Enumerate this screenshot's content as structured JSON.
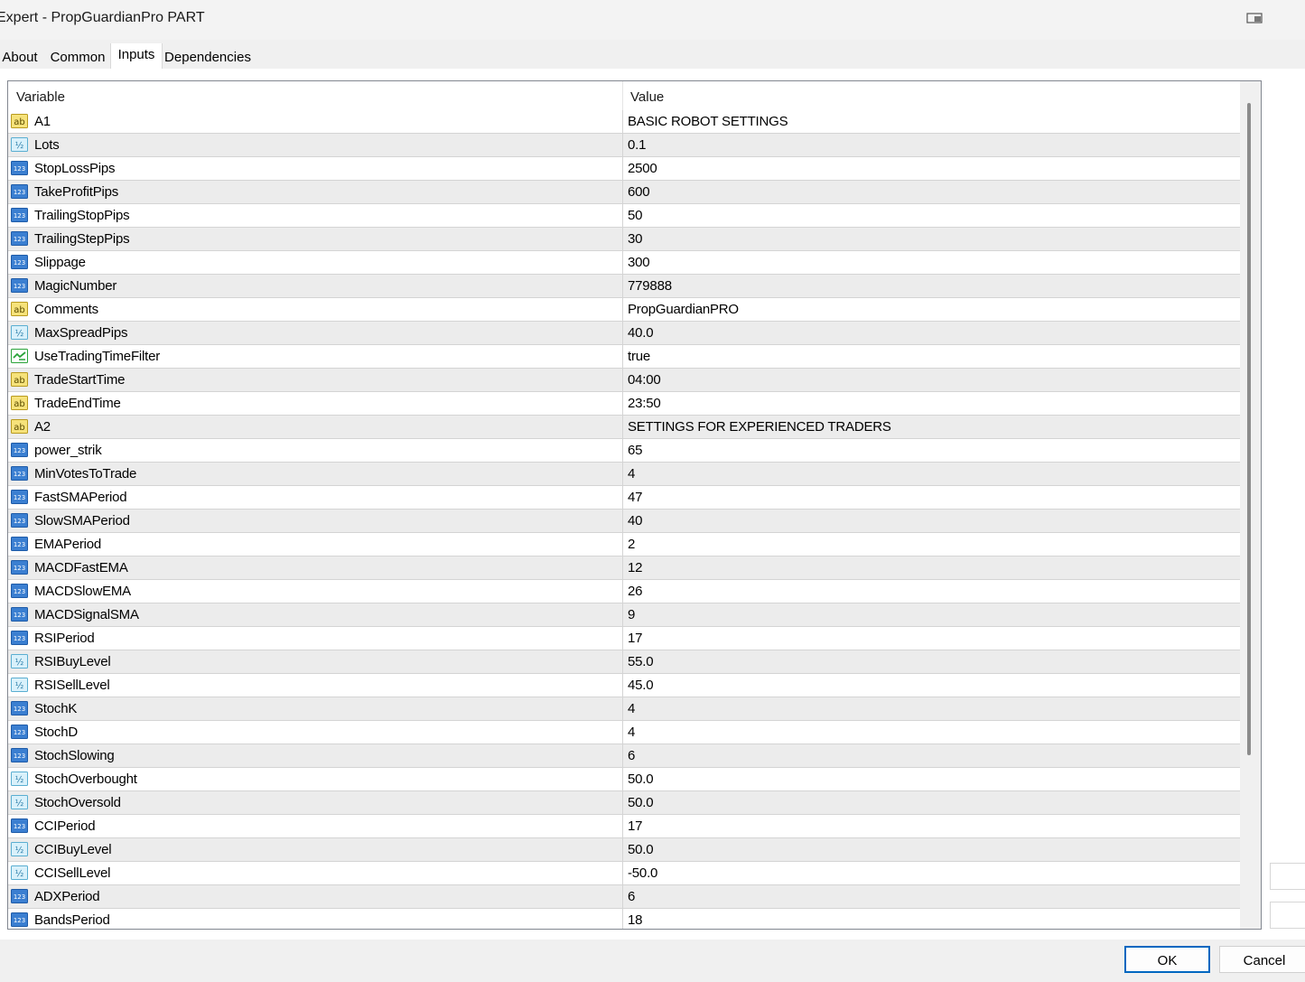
{
  "window": {
    "title": "Expert - PropGuardianPro PART"
  },
  "tabs": [
    {
      "label": "About",
      "active": false
    },
    {
      "label": "Common",
      "active": false
    },
    {
      "label": "Inputs",
      "active": true
    },
    {
      "label": "Dependencies",
      "active": false
    }
  ],
  "grid": {
    "columns": {
      "variable": "Variable",
      "value": "Value"
    },
    "rows": [
      {
        "type": "string",
        "icon": "string-type-icon",
        "name": "A1",
        "value": "BASIC ROBOT SETTINGS"
      },
      {
        "type": "double",
        "icon": "double-type-icon",
        "name": "Lots",
        "value": "0.1"
      },
      {
        "type": "int",
        "icon": "integer-type-icon",
        "name": "StopLossPips",
        "value": "2500"
      },
      {
        "type": "int",
        "icon": "integer-type-icon",
        "name": "TakeProfitPips",
        "value": "600"
      },
      {
        "type": "int",
        "icon": "integer-type-icon",
        "name": "TrailingStopPips",
        "value": "50"
      },
      {
        "type": "int",
        "icon": "integer-type-icon",
        "name": "TrailingStepPips",
        "value": "30"
      },
      {
        "type": "int",
        "icon": "integer-type-icon",
        "name": "Slippage",
        "value": "300"
      },
      {
        "type": "int",
        "icon": "integer-type-icon",
        "name": "MagicNumber",
        "value": "779888"
      },
      {
        "type": "string",
        "icon": "string-type-icon",
        "name": "Comments",
        "value": "PropGuardianPRO"
      },
      {
        "type": "double",
        "icon": "double-type-icon",
        "name": "MaxSpreadPips",
        "value": "40.0"
      },
      {
        "type": "bool",
        "icon": "boolean-type-icon",
        "name": "UseTradingTimeFilter",
        "value": "true"
      },
      {
        "type": "string",
        "icon": "string-type-icon",
        "name": "TradeStartTime",
        "value": "04:00"
      },
      {
        "type": "string",
        "icon": "string-type-icon",
        "name": "TradeEndTime",
        "value": "23:50"
      },
      {
        "type": "string",
        "icon": "string-type-icon",
        "name": "A2",
        "value": "SETTINGS FOR EXPERIENCED TRADERS"
      },
      {
        "type": "int",
        "icon": "integer-type-icon",
        "name": "power_strik",
        "value": "65"
      },
      {
        "type": "int",
        "icon": "integer-type-icon",
        "name": "MinVotesToTrade",
        "value": "4"
      },
      {
        "type": "int",
        "icon": "integer-type-icon",
        "name": "FastSMAPeriod",
        "value": "47"
      },
      {
        "type": "int",
        "icon": "integer-type-icon",
        "name": "SlowSMAPeriod",
        "value": "40"
      },
      {
        "type": "int",
        "icon": "integer-type-icon",
        "name": "EMAPeriod",
        "value": "2"
      },
      {
        "type": "int",
        "icon": "integer-type-icon",
        "name": "MACDFastEMA",
        "value": "12"
      },
      {
        "type": "int",
        "icon": "integer-type-icon",
        "name": "MACDSlowEMA",
        "value": "26"
      },
      {
        "type": "int",
        "icon": "integer-type-icon",
        "name": "MACDSignalSMA",
        "value": "9"
      },
      {
        "type": "int",
        "icon": "integer-type-icon",
        "name": "RSIPeriod",
        "value": "17"
      },
      {
        "type": "double",
        "icon": "double-type-icon",
        "name": "RSIBuyLevel",
        "value": "55.0"
      },
      {
        "type": "double",
        "icon": "double-type-icon",
        "name": "RSISellLevel",
        "value": "45.0"
      },
      {
        "type": "int",
        "icon": "integer-type-icon",
        "name": "StochK",
        "value": "4"
      },
      {
        "type": "int",
        "icon": "integer-type-icon",
        "name": "StochD",
        "value": "4"
      },
      {
        "type": "int",
        "icon": "integer-type-icon",
        "name": "StochSlowing",
        "value": "6"
      },
      {
        "type": "double",
        "icon": "double-type-icon",
        "name": "StochOverbought",
        "value": "50.0"
      },
      {
        "type": "double",
        "icon": "double-type-icon",
        "name": "StochOversold",
        "value": "50.0"
      },
      {
        "type": "int",
        "icon": "integer-type-icon",
        "name": "CCIPeriod",
        "value": "17"
      },
      {
        "type": "double",
        "icon": "double-type-icon",
        "name": "CCIBuyLevel",
        "value": "50.0"
      },
      {
        "type": "double",
        "icon": "double-type-icon",
        "name": "CCISellLevel",
        "value": "-50.0"
      },
      {
        "type": "int",
        "icon": "integer-type-icon",
        "name": "ADXPeriod",
        "value": "6"
      },
      {
        "type": "int",
        "icon": "integer-type-icon",
        "name": "BandsPeriod",
        "value": "18"
      }
    ]
  },
  "icon_glyphs": {
    "string": "ab",
    "double": "½",
    "int": "123"
  },
  "colors": {
    "string_icon_bg": "#f6e27a",
    "double_icon_bg": "#d9f1fb",
    "int_icon_bg": "#3b7fd1",
    "bool_icon_color": "#2aa33a",
    "accent": "#0067c0"
  },
  "buttons": {
    "ok": "OK",
    "cancel": "Cancel"
  }
}
